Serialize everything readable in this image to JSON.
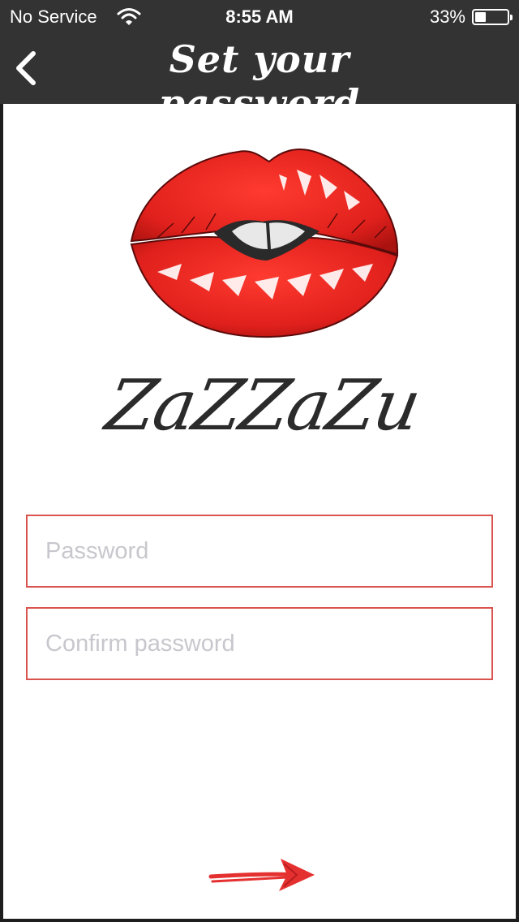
{
  "status_bar": {
    "carrier": "No Service",
    "time": "8:55 AM",
    "battery_percent_text": "33%",
    "battery_level": 0.33,
    "wifi_icon": "wifi-icon"
  },
  "navbar": {
    "title": "Set your password",
    "back_icon": "chevron-left-icon"
  },
  "brand": {
    "logo_image": "red-lips-illustration",
    "name": "ZaZZaZu"
  },
  "form": {
    "password": {
      "value": "",
      "placeholder": "Password"
    },
    "confirm_password": {
      "value": "",
      "placeholder": "Confirm password"
    }
  },
  "next_button": {
    "icon": "arrow-right-icon"
  },
  "colors": {
    "topbar": "#333333",
    "accent": "#d9534f",
    "lips_red": "#e0201c",
    "brand_text": "#2b2b2b",
    "placeholder": "#c7c7cd"
  }
}
